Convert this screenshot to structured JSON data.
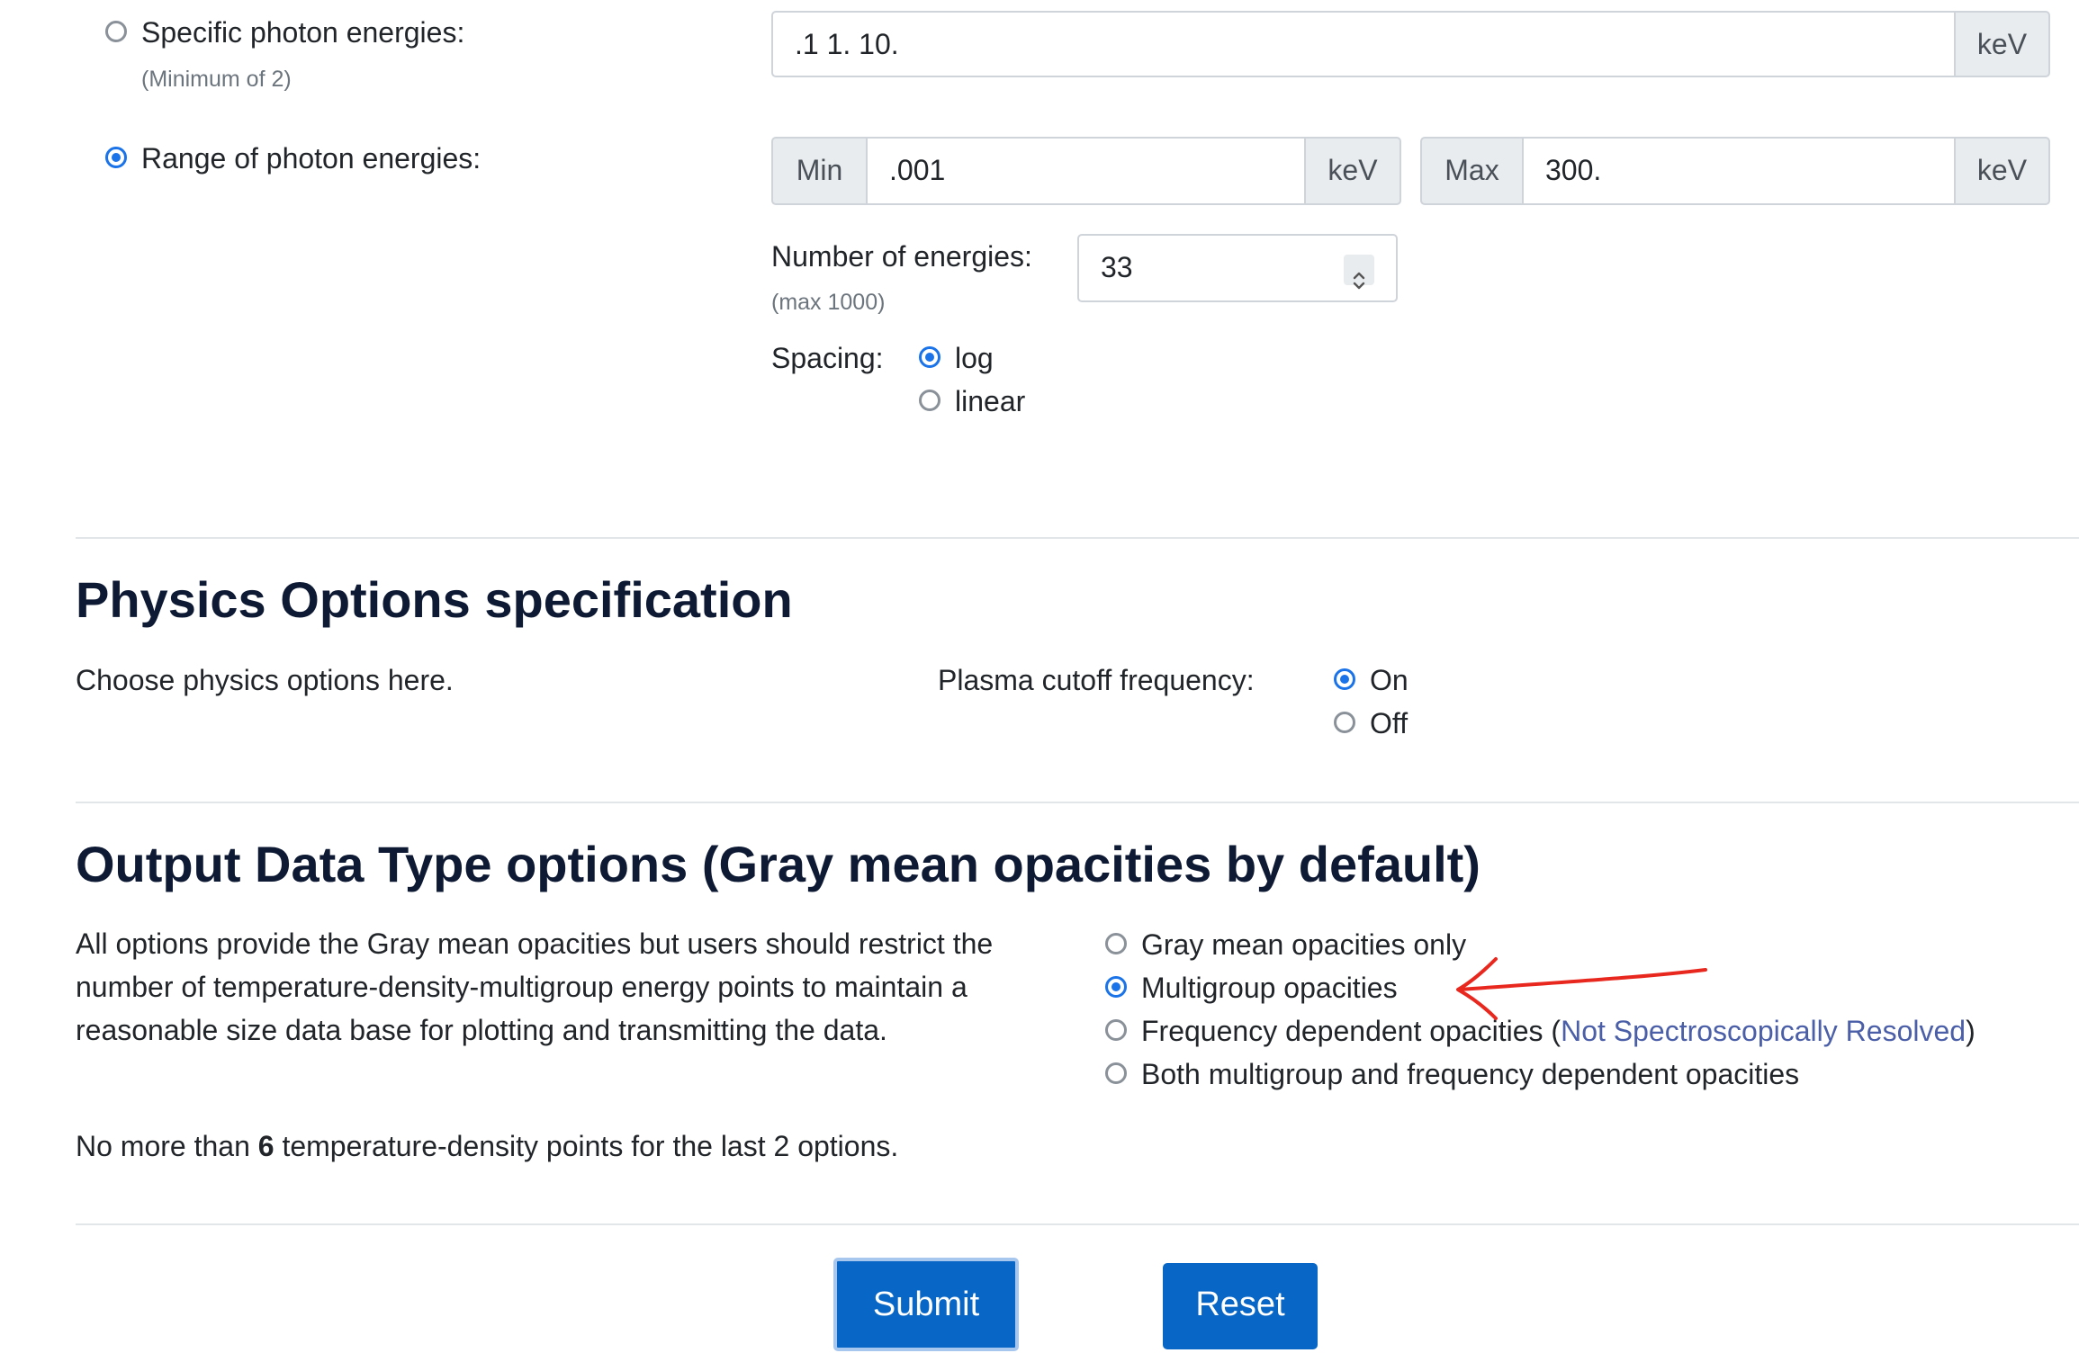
{
  "energies": {
    "specific": {
      "label": "Specific photon energies:",
      "note": "(Minimum of 2)",
      "value": ".1 1. 10.",
      "unit": "keV",
      "selected": false
    },
    "range": {
      "label": "Range of photon energies:",
      "selected": true,
      "min_label": "Min",
      "min_value": ".001",
      "min_unit": "keV",
      "max_label": "Max",
      "max_value": "300.",
      "max_unit": "keV"
    },
    "number": {
      "label": "Number of energies:",
      "note": "(max 1000)",
      "value": "33"
    },
    "spacing": {
      "label": "Spacing:",
      "options": [
        {
          "label": "log",
          "selected": true
        },
        {
          "label": "linear",
          "selected": false
        }
      ]
    }
  },
  "physics": {
    "heading": "Physics Options specification",
    "description": "Choose physics options here.",
    "plasma_label": "Plasma cutoff frequency:",
    "options": [
      {
        "label": "On",
        "selected": true
      },
      {
        "label": "Off",
        "selected": false
      }
    ]
  },
  "output": {
    "heading": "Output Data Type options (Gray mean opacities by default)",
    "paragraph": "All options provide the Gray mean opacities but users should restrict the number of temperature-density-multigroup energy points to maintain a reasonable size data base for plotting and transmitting the data.",
    "note_prefix": "No more than ",
    "note_bold": "6",
    "note_suffix": " temperature-density points for the last 2 options.",
    "options": [
      {
        "label": "Gray mean opacities only",
        "selected": false
      },
      {
        "label": "Multigroup opacities",
        "selected": true
      },
      {
        "label_prefix": "Frequency dependent opacities (",
        "link": "Not Spectroscopically Resolved",
        "label_suffix": ")",
        "selected": false
      },
      {
        "label": "Both multigroup and frequency dependent opacities",
        "selected": false
      }
    ]
  },
  "buttons": {
    "submit": "Submit",
    "reset": "Reset"
  },
  "colors": {
    "accent": "#1a73e8",
    "button": "#0866c6",
    "annotation": "#e8281e",
    "link": "#4b5fa8"
  },
  "icons": {
    "stepper": "spinner-arrows-icon",
    "annotation": "red-arrow-annotation-icon"
  }
}
